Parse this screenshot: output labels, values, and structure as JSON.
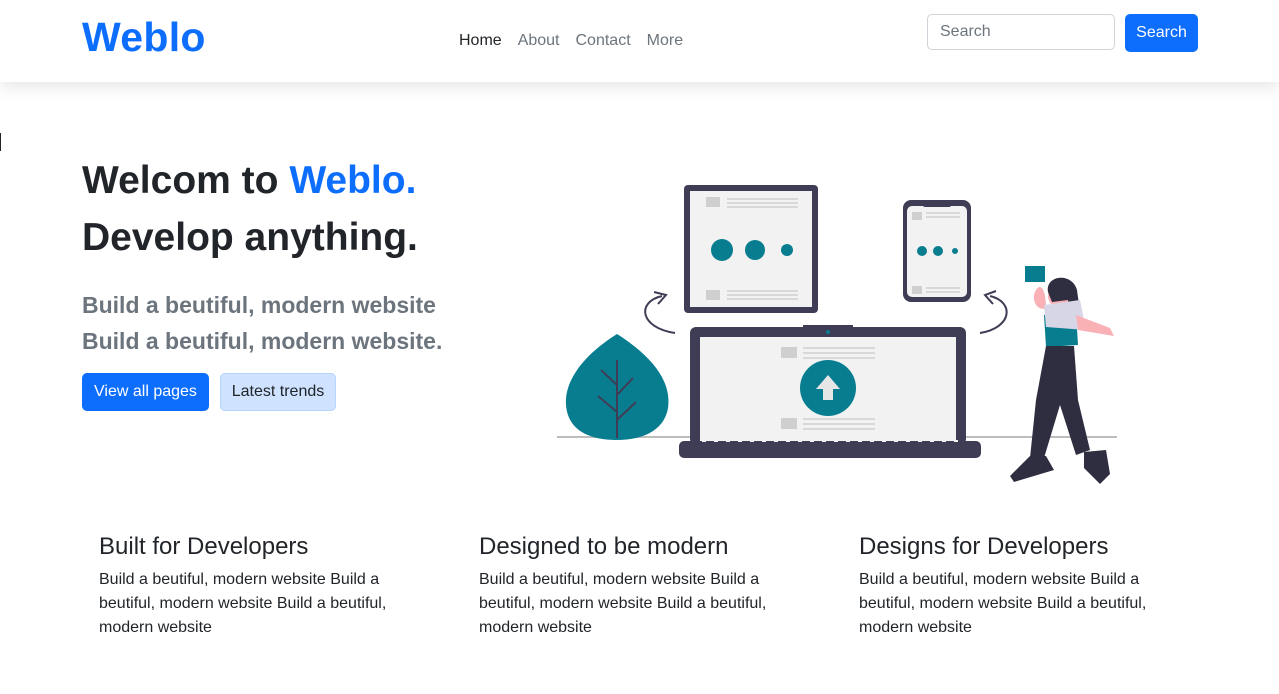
{
  "brand": "Weblo",
  "nav": {
    "items": [
      {
        "label": "Home",
        "active": true
      },
      {
        "label": "About",
        "active": false
      },
      {
        "label": "Contact",
        "active": false
      },
      {
        "label": "More",
        "active": false
      }
    ]
  },
  "search": {
    "placeholder": "Search",
    "button_label": "Search"
  },
  "hero": {
    "title_prefix": "Welcom to ",
    "title_accent": "Weblo.",
    "title_line2": "Develop anything.",
    "subtitle_line1": "Build a beutiful, modern website",
    "subtitle_line2": "Build a beutiful, modern website.",
    "primary_button": "View all pages",
    "secondary_button": "Latest trends"
  },
  "features": [
    {
      "title": "Built for Developers",
      "text": "Build a beutiful, modern website Build a beutiful, modern website Build a beutiful, modern website"
    },
    {
      "title": "Designed to be modern",
      "text": "Build a beutiful, modern website Build a beutiful, modern website Build a beutiful, modern website"
    },
    {
      "title": "Designs for Developers",
      "text": "Build a beutiful, modern website Build a beutiful, modern website Build a beutiful, modern website"
    }
  ],
  "colors": {
    "primary": "#0d6efd",
    "accent_teal": "#087d8f",
    "dark": "#3f3d56",
    "muted": "#6c757d"
  },
  "illustration_icon": "web-development-illustration"
}
